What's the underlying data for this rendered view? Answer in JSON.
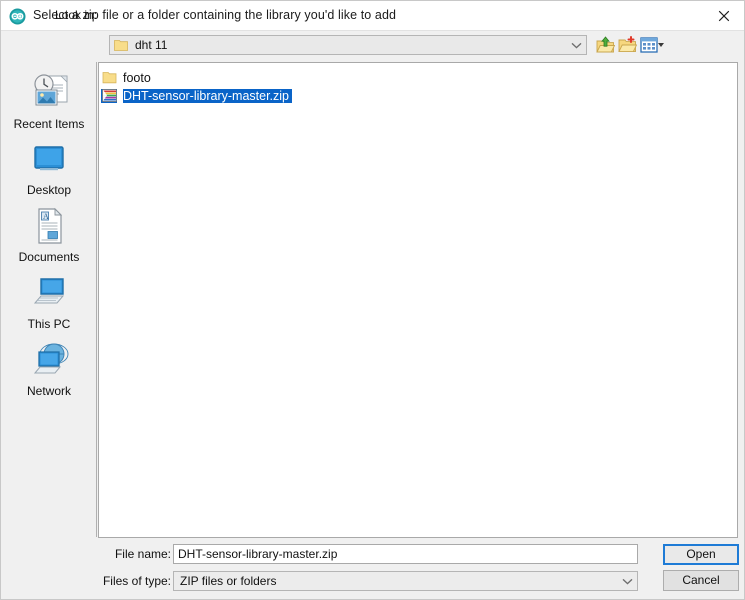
{
  "window": {
    "title": "Select a zip file or a folder containing the library you'd like to add",
    "logo_icon": "arduino-logo-icon",
    "close_icon": "close-icon"
  },
  "toolbar": {
    "look_in_label": "Look in:",
    "look_in_value": "dht 11",
    "look_in_folder_icon": "folder-icon",
    "look_in_dropdown_icon": "chevron-down-icon",
    "up_one_level_icon": "up-one-level-icon",
    "create_new_folder_icon": "create-new-folder-icon",
    "view_menu_icon": "view-menu-icon",
    "view_menu_caret_icon": "caret-down-icon"
  },
  "sidebar": {
    "items": [
      {
        "label": "Recent Items",
        "icon": "recent-items-icon"
      },
      {
        "label": "Desktop",
        "icon": "desktop-icon"
      },
      {
        "label": "Documents",
        "icon": "documents-icon"
      },
      {
        "label": "This PC",
        "icon": "this-pc-icon"
      },
      {
        "label": "Network",
        "icon": "network-icon"
      }
    ]
  },
  "file_list": {
    "entries": [
      {
        "name": "footo",
        "icon": "folder-icon",
        "type": "folder",
        "selected": false
      },
      {
        "name": "DHT-sensor-library-master.zip",
        "icon": "zip-archive-icon",
        "type": "file",
        "selected": true
      }
    ]
  },
  "form": {
    "file_name_label": "File name:",
    "file_name_value": "DHT-sensor-library-master.zip",
    "files_of_type_label": "Files of type:",
    "files_of_type_value": "ZIP files or folders",
    "files_of_type_dropdown_icon": "chevron-down-icon"
  },
  "buttons": {
    "open": "Open",
    "cancel": "Cancel"
  },
  "colors": {
    "selection_blue": "#0a64c8",
    "focus_blue": "#1e7bd6",
    "arduino_teal": "#00979c",
    "folder_yellow": "#f7d775",
    "panel_gray": "#f0f0f0"
  }
}
